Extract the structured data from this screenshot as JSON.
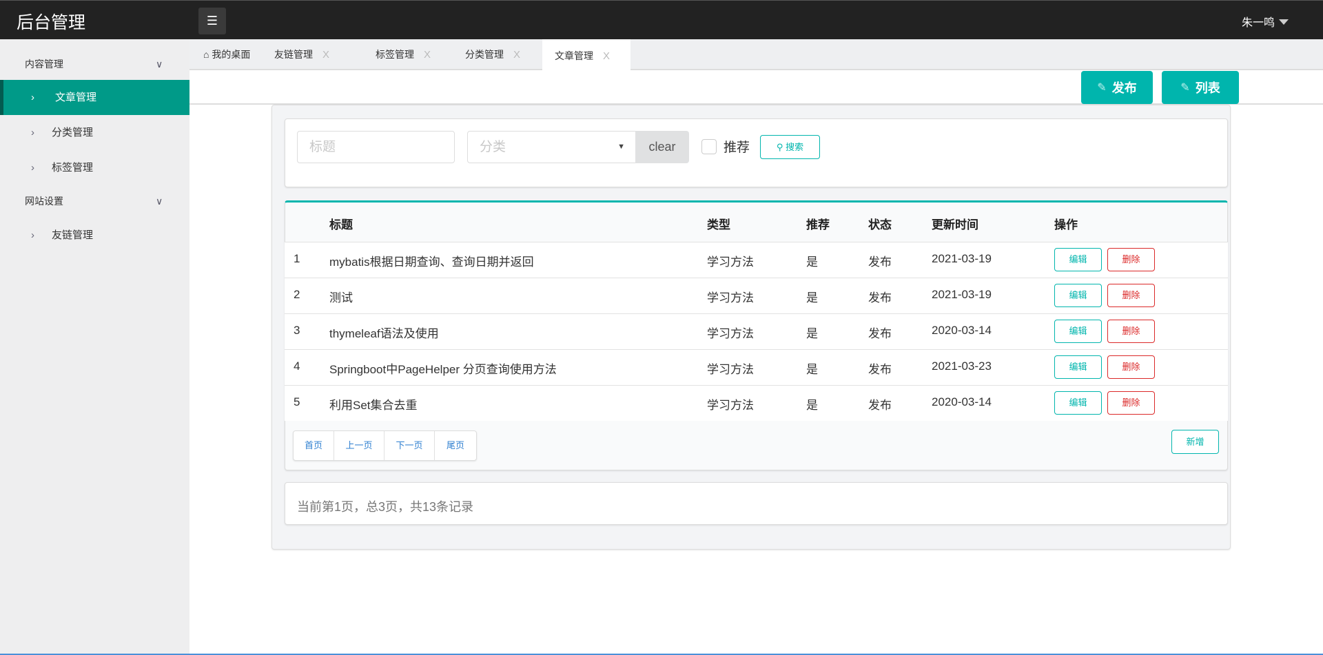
{
  "header": {
    "logo": "后台管理",
    "menu_icon": "list-icon",
    "user": "朱一鸣"
  },
  "sidebar": {
    "groups": [
      {
        "label": "内容管理",
        "items": [
          {
            "label": "文章管理",
            "active": true
          },
          {
            "label": "分类管理"
          },
          {
            "label": "标签管理"
          }
        ]
      },
      {
        "label": "网站设置",
        "items": [
          {
            "label": "友链管理"
          }
        ]
      }
    ]
  },
  "tabs": [
    {
      "label": "我的桌面",
      "icon": "home-icon"
    },
    {
      "label": "友链管理",
      "close": "X"
    },
    {
      "label": "标签管理",
      "close": "X"
    },
    {
      "label": "分类管理",
      "close": "X"
    },
    {
      "label": "文章管理",
      "close": "X",
      "active": true
    }
  ],
  "toolbar": {
    "publish": "发布",
    "list": "列表"
  },
  "search": {
    "title_placeholder": "标题",
    "category_placeholder": "分类",
    "clear": "clear",
    "recommend": "推荐",
    "search": "搜索"
  },
  "table": {
    "columns": [
      "",
      "标题",
      "类型",
      "推荐",
      "状态",
      "更新时间",
      "操作"
    ],
    "rows": [
      {
        "no": "1",
        "title": "mybatis根据日期查询、查询日期并返回",
        "type": "学习方法",
        "recommend": "是",
        "status": "发布",
        "updated": "2021-03-19"
      },
      {
        "no": "2",
        "title": "测试",
        "type": "学习方法",
        "recommend": "是",
        "status": "发布",
        "updated": "2021-03-19"
      },
      {
        "no": "3",
        "title": "thymeleaf语法及使用",
        "type": "学习方法",
        "recommend": "是",
        "status": "发布",
        "updated": "2020-03-14"
      },
      {
        "no": "4",
        "title": "Springboot中PageHelper 分页查询使用方法",
        "type": "学习方法",
        "recommend": "是",
        "status": "发布",
        "updated": "2021-03-23"
      },
      {
        "no": "5",
        "title": "利用Set集合去重",
        "type": "学习方法",
        "recommend": "是",
        "status": "发布",
        "updated": "2020-03-14"
      }
    ],
    "edit": "编辑",
    "delete": "删除"
  },
  "pager": {
    "first": "首页",
    "prev": "上一页",
    "next": "下一页",
    "last": "尾页",
    "add": "新增"
  },
  "info": "当前第1页，总3页，共13条记录",
  "colors": {
    "header": "#222222",
    "accent": "#00b5ad",
    "sidebar_active": "#009a88",
    "danger": "#db2828",
    "link": "#2e7fd0"
  }
}
